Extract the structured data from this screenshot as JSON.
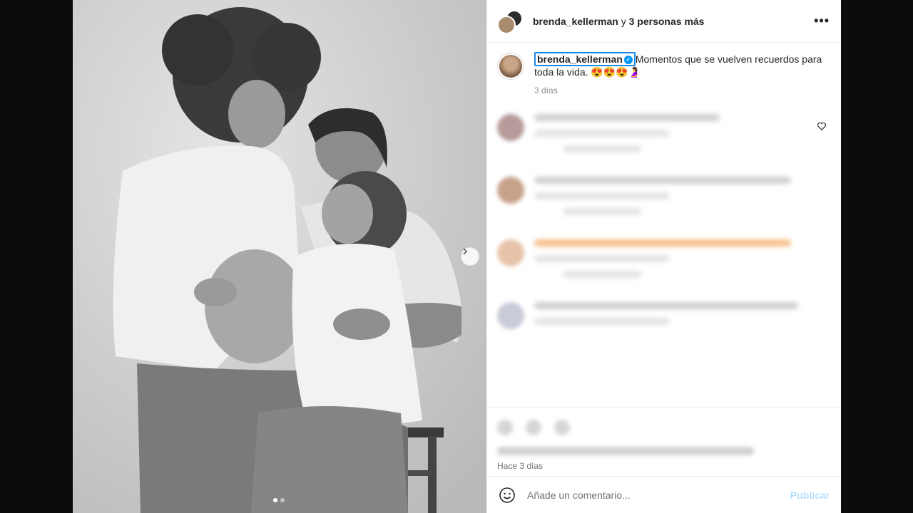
{
  "header": {
    "username": "brenda_kellerman",
    "connector": "y",
    "others": "3 personas más",
    "more_icon": "more-horizontal-icon"
  },
  "caption": {
    "username": "brenda_kellerman",
    "verified": true,
    "text": "Momentos que se vuelven recuerdos para toda la vida. 😍😍😍🤰",
    "time": "3 días"
  },
  "post": {
    "time_label": "Hace 3 días"
  },
  "comment_box": {
    "placeholder": "Añade un comentario...",
    "publish_label": "Publicar"
  },
  "carousel": {
    "total_slides": 2,
    "current_slide": 1
  },
  "colors": {
    "accent": "#0095f6",
    "publish_disabled": "#b2dffc",
    "focus_outline": "#1e88e5"
  }
}
